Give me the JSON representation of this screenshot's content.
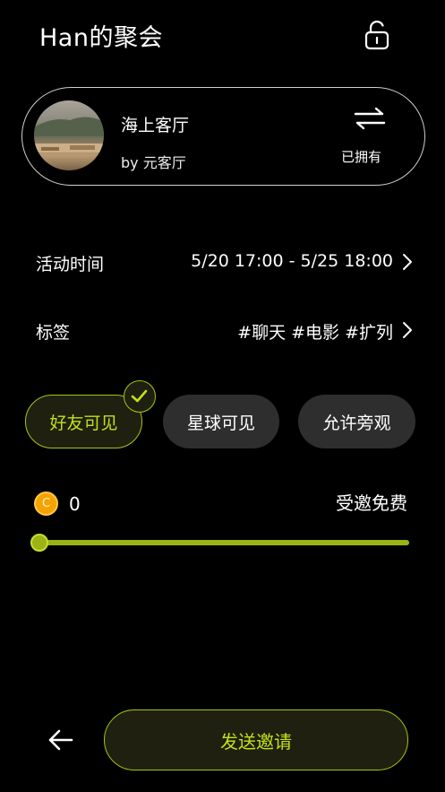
{
  "header": {
    "title": "Han的聚会",
    "lock_icon": "unlock-icon"
  },
  "room": {
    "name": "海上客厅",
    "by": "by 元客厅",
    "swap_icon": "swap-arrows-icon",
    "owned_label": "已拥有"
  },
  "activity_time": {
    "label": "活动时间",
    "value": "5/20 17:00 - 5/25 18:00"
  },
  "tags": {
    "label": "标签",
    "value": "#聊天 #电影 #扩列"
  },
  "visibility": {
    "options": [
      "好友可见",
      "星球可见",
      "允许旁观"
    ],
    "selected": "好友可见"
  },
  "fee": {
    "coin_symbol": "C",
    "amount": "0",
    "label": "受邀免费",
    "slider_value": 0
  },
  "footer": {
    "send_label": "发送邀请",
    "back_icon": "back-arrow-icon"
  },
  "colors": {
    "accent": "#a7c414",
    "accent_text": "#c3e01c",
    "coin": "#f5a300",
    "background": "#000000"
  }
}
